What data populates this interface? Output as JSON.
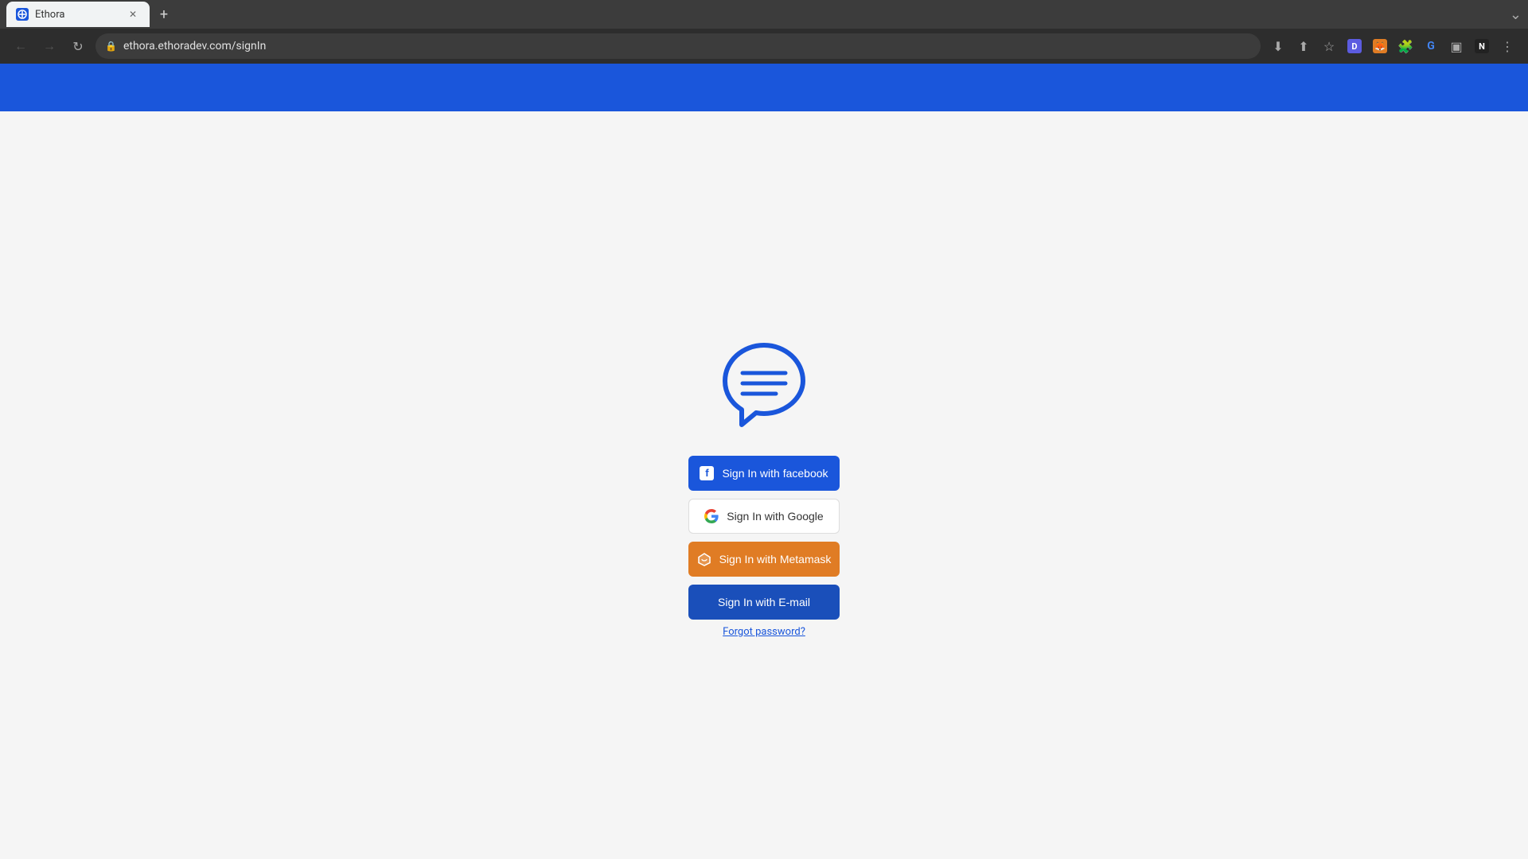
{
  "browser": {
    "tab_title": "Ethora",
    "url": "ethora.ethoradev.com/signIn",
    "new_tab_label": "+",
    "nav": {
      "back": "←",
      "forward": "→",
      "refresh": "↻"
    }
  },
  "header": {
    "bg_color": "#1a56db"
  },
  "signin": {
    "facebook_btn": "Sign In with facebook",
    "google_btn": "Sign In with Google",
    "metamask_btn": "Sign In with Metamask",
    "email_btn": "Sign In with E-mail",
    "forgot_password": "Forgot password?",
    "colors": {
      "facebook": "#1a56db",
      "google_bg": "#ffffff",
      "google_text": "#333333",
      "metamask": "#e07c24",
      "email": "#1a4fba"
    }
  }
}
